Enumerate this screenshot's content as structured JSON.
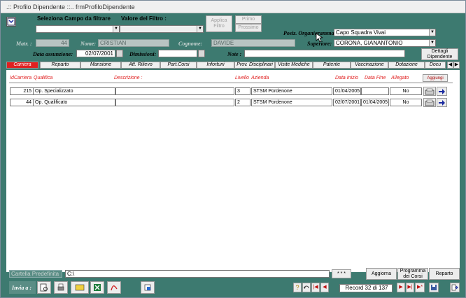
{
  "window": {
    "title": ".:: Profilo Dipendente ::..   frmProfiloDipendente"
  },
  "filter": {
    "campo_label": "Seleziona Campo da filtrare",
    "valore_label": "Valore del Filtro :",
    "applica": "Applica Filtro",
    "primo": "Primo",
    "prossimo": "Prossimo"
  },
  "employee": {
    "matr_label": "Matr. :",
    "matr_value": "44",
    "nome_label": "Nome:",
    "nome_value": "CRISTIAN",
    "cognome_label": "Cognome:",
    "cognome_value": "DAVIDE",
    "pos_label": "Posiz. Organigramma",
    "pos_value": "Capo Squadra Vivai",
    "sup_label": "Superiore:",
    "sup_value": "CORONA, GIANANTONIO",
    "assunz_label": "Data assunzione:",
    "assunz_value": "02/07/2001",
    "dimiss_label": "Dimissioni:",
    "dimiss_value": "",
    "note_label": "Note :",
    "note_value": "",
    "dettagli": "Dettagli Dipendente"
  },
  "tabs": [
    "Carriera",
    "Reparto",
    "Mansione",
    "Att. Rilievo",
    "Part.Corsi",
    "Infortuni",
    "Prov. Disciplinari",
    "Visite Mediche",
    "Patente",
    "Vaccinazione",
    "Dotazione",
    "Docu"
  ],
  "table": {
    "headers": {
      "id": "IdCarriera",
      "qualifica": "Qualifica",
      "descr": "Descrizione :",
      "livello": "Livello",
      "azienda": "Azienda",
      "inizio": "Data Inizio",
      "fine": "Data Fine",
      "allegato": "Allegato",
      "aggiungi": "Aggiungi"
    },
    "rows": [
      {
        "id": "215",
        "qualifica": "Op. Specializzato",
        "descr": "",
        "livello": "3",
        "azienda": "STSM Pordenone",
        "inizio": "01/04/2005",
        "fine": "",
        "allegato": "No"
      },
      {
        "id": "44",
        "qualifica": "Op. Qualificato",
        "descr": "",
        "livello": "2",
        "azienda": "STSM Pordenone",
        "inizio": "02/07/2001",
        "fine": "01/04/2005",
        "allegato": "No"
      }
    ]
  },
  "footer": {
    "cartella_label": "Cartella Predefinita",
    "cartella_value": "C:\\",
    "dots": "* * *",
    "aggiorna": "Aggiorna",
    "programma": "Programma dei Corsi",
    "reparto": "Reparto",
    "invia": "Invia a :",
    "record": "Record 32 di 137"
  },
  "colors": {
    "background": "#3d7a70",
    "active_tab": "#e02020",
    "header_text": "#e02020",
    "arrow_blue": "#1a2aa0"
  }
}
